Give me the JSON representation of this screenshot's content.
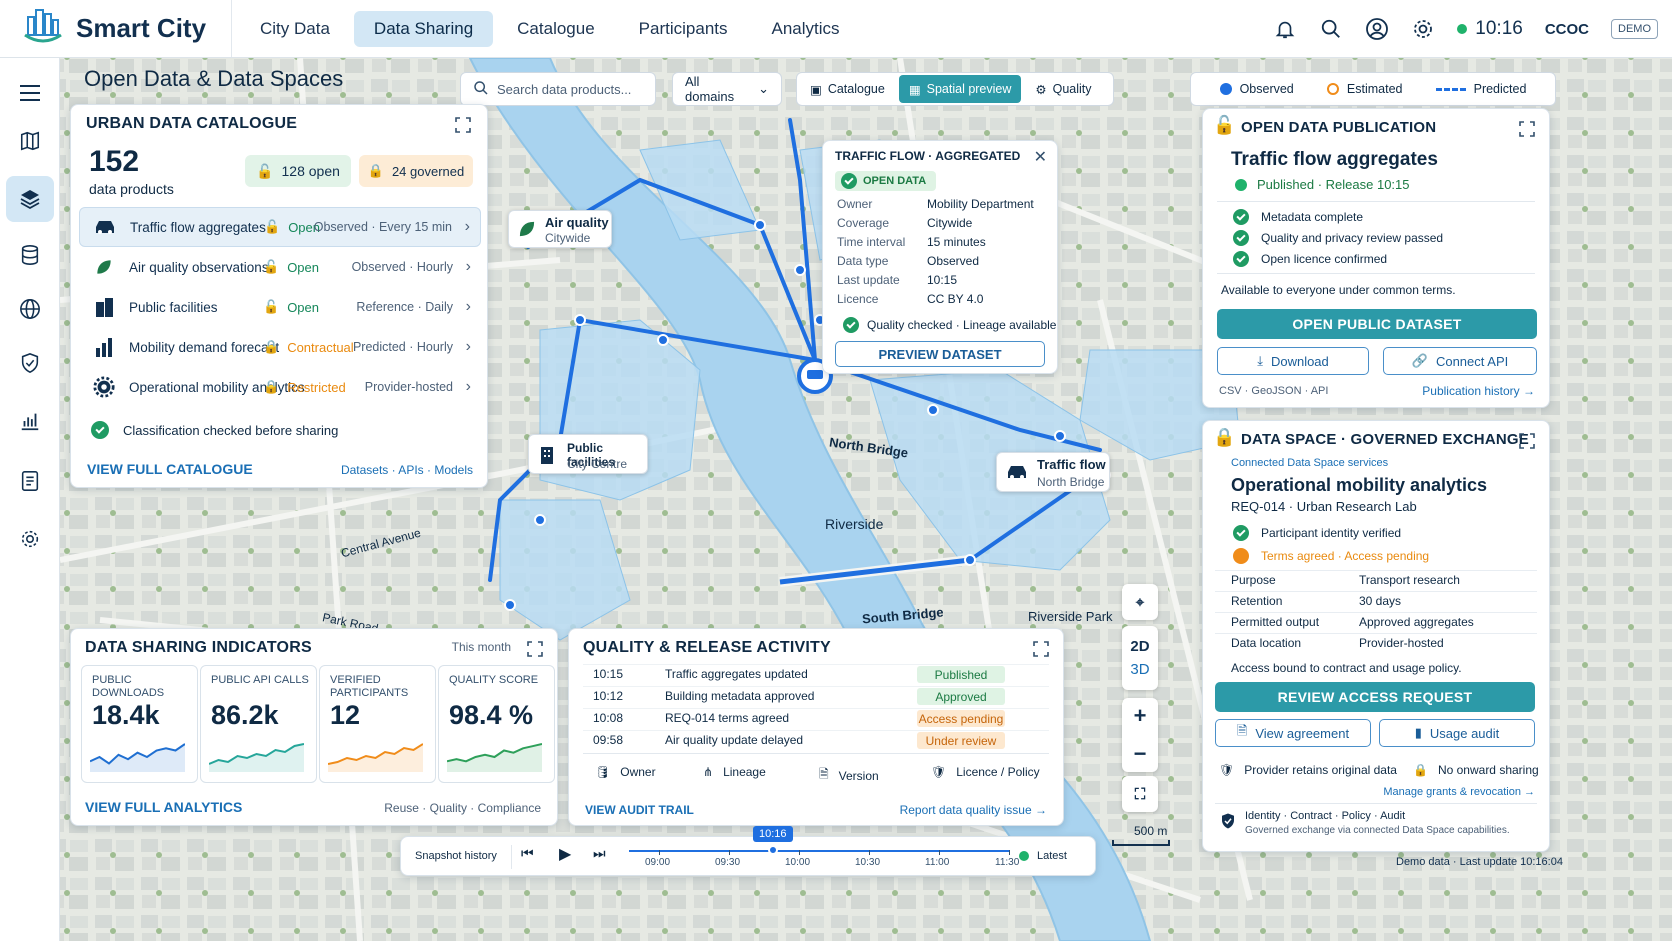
{
  "app": {
    "name": "Smart City",
    "org": "CCOC",
    "demo": "DEMO",
    "time": "10:16"
  },
  "nav": [
    "City Data",
    "Data Sharing",
    "Catalogue",
    "Participants",
    "Analytics"
  ],
  "page_title": "Open Data & Data Spaces",
  "search": {
    "placeholder": "Search data products..."
  },
  "domain_select": "All domains",
  "view_tabs": [
    "Catalogue",
    "Spatial preview",
    "Quality"
  ],
  "legend": {
    "observed": "Observed",
    "estimated": "Estimated",
    "predicted": "Predicted"
  },
  "catalogue": {
    "title": "URBAN DATA CATALOGUE",
    "count": "152",
    "count_label": "data products",
    "open_badge": "128 open",
    "governed_badge": "24 governed",
    "rows": [
      {
        "name": "Traffic flow aggregates",
        "access": "Open",
        "freq": "Observed · Every 15 min",
        "icon": "car-icon"
      },
      {
        "name": "Air quality observations",
        "access": "Open",
        "freq": "Observed · Hourly",
        "icon": "leaf-icon"
      },
      {
        "name": "Public facilities",
        "access": "Open",
        "freq": "Reference · Daily",
        "icon": "building-icon"
      },
      {
        "name": "Mobility demand forecast",
        "access": "Contractual",
        "freq": "Predicted · Hourly",
        "icon": "bar-chart-icon"
      },
      {
        "name": "Operational mobility analytics",
        "access": "Restricted",
        "freq": "Provider-hosted",
        "icon": "gear-icon"
      }
    ],
    "classification": "Classification checked before sharing",
    "view_full": "VIEW FULL CATALOGUE",
    "links": "Datasets · APIs · Models"
  },
  "map_labels": {
    "air_title": "Air quality",
    "air_sub": "Citywide",
    "pub_title": "Public facilities",
    "pub_sub": "City Centre",
    "traffic_title": "Traffic flow",
    "traffic_sub": "North Bridge",
    "north_bridge": "North Bridge",
    "south_bridge": "South Bridge",
    "riverside": "Riverside",
    "riverside_park": "Riverside Park",
    "central_avenue": "Central Avenue",
    "park_road": "Park Road",
    "scale": "500 m"
  },
  "popup": {
    "title": "TRAFFIC FLOW · AGGREGATED",
    "badge": "OPEN DATA",
    "fields": [
      {
        "k": "Owner",
        "v": "Mobility Department"
      },
      {
        "k": "Coverage",
        "v": "Citywide"
      },
      {
        "k": "Time interval",
        "v": "15 minutes"
      },
      {
        "k": "Data type",
        "v": "Observed"
      },
      {
        "k": "Last update",
        "v": "10:15"
      },
      {
        "k": "Licence",
        "v": "CC BY 4.0"
      }
    ],
    "quality": "Quality checked · Lineage available",
    "button": "PREVIEW DATASET"
  },
  "publication": {
    "title": "OPEN DATA PUBLICATION",
    "name": "Traffic flow aggregates",
    "status": "Published · Release 10:15",
    "checks": [
      "Metadata complete",
      "Quality and privacy review passed",
      "Open licence confirmed"
    ],
    "note": "Available to everyone under common terms.",
    "primary": "OPEN PUBLIC DATASET",
    "download": "Download",
    "connect": "Connect API",
    "formats": "CSV · GeoJSON · API",
    "history": "Publication history →"
  },
  "dataspace": {
    "title": "DATA SPACE · GOVERNED EXCHANGE",
    "sub": "Connected Data Space services",
    "name": "Operational mobility analytics",
    "req": "REQ-014 · Urban Research Lab",
    "check1": "Participant identity verified",
    "check2": "Terms agreed · Access pending",
    "fields": [
      {
        "k": "Purpose",
        "v": "Transport research"
      },
      {
        "k": "Retention",
        "v": "30 days"
      },
      {
        "k": "Permitted output",
        "v": "Approved aggregates"
      },
      {
        "k": "Data location",
        "v": "Provider-hosted"
      }
    ],
    "note": "Access bound to contract and usage policy.",
    "primary": "REVIEW ACCESS REQUEST",
    "agreement": "View agreement",
    "audit": "Usage audit",
    "retains": "Provider retains original data",
    "onward": "No onward sharing",
    "grants": "Manage grants & revocation →",
    "identity": "Identity · Contract · Policy · Audit",
    "identity_sub": "Governed exchange via connected Data Space capabilities."
  },
  "indicators": {
    "title": "DATA SHARING INDICATORS",
    "period": "This month",
    "kpis": [
      {
        "label": "PUBLIC DOWNLOADS",
        "value": "18.4k",
        "color": "#1f6fd1"
      },
      {
        "label": "PUBLIC API CALLS",
        "value": "86.2k",
        "color": "#26a69a"
      },
      {
        "label": "VERIFIED PARTICIPANTS",
        "value": "12",
        "color": "#f08c1a"
      },
      {
        "label": "QUALITY SCORE",
        "value": "98.4 %",
        "color": "#2ea05a"
      }
    ],
    "view_full": "VIEW FULL ANALYTICS",
    "links": "Reuse · Quality · Compliance"
  },
  "activity": {
    "title": "QUALITY & RELEASE ACTIVITY",
    "rows": [
      {
        "time": "10:15",
        "text": "Traffic aggregates updated",
        "status": "Published",
        "kind": "green"
      },
      {
        "time": "10:12",
        "text": "Building metadata approved",
        "status": "Approved",
        "kind": "green"
      },
      {
        "time": "10:08",
        "text": "REQ-014 terms agreed",
        "status": "Access pending",
        "kind": "orange"
      },
      {
        "time": "09:58",
        "text": "Air quality update delayed",
        "status": "Under review",
        "kind": "orange"
      }
    ],
    "tools": [
      "Owner",
      "Lineage",
      "Version",
      "Licence / Policy"
    ],
    "audit": "VIEW AUDIT TRAIL",
    "report": "Report data quality issue →"
  },
  "map_controls": {
    "view2d": "2D",
    "view3d": "3D",
    "zoom_in": "+",
    "zoom_out": "−"
  },
  "timeline": {
    "label": "Snapshot history",
    "current": "10:16",
    "ticks": [
      "09:00",
      "09:30",
      "10:00",
      "10:30",
      "11:00",
      "11:30"
    ],
    "latest": "Latest",
    "position": 0.38
  },
  "footer": "Demo data · Last update 10:16:04",
  "colors": {
    "accent": "#2c9aa8",
    "brand": "#12304f",
    "open": "#15875a",
    "governed": "#e98a0f",
    "route": "#1f6fe0"
  }
}
